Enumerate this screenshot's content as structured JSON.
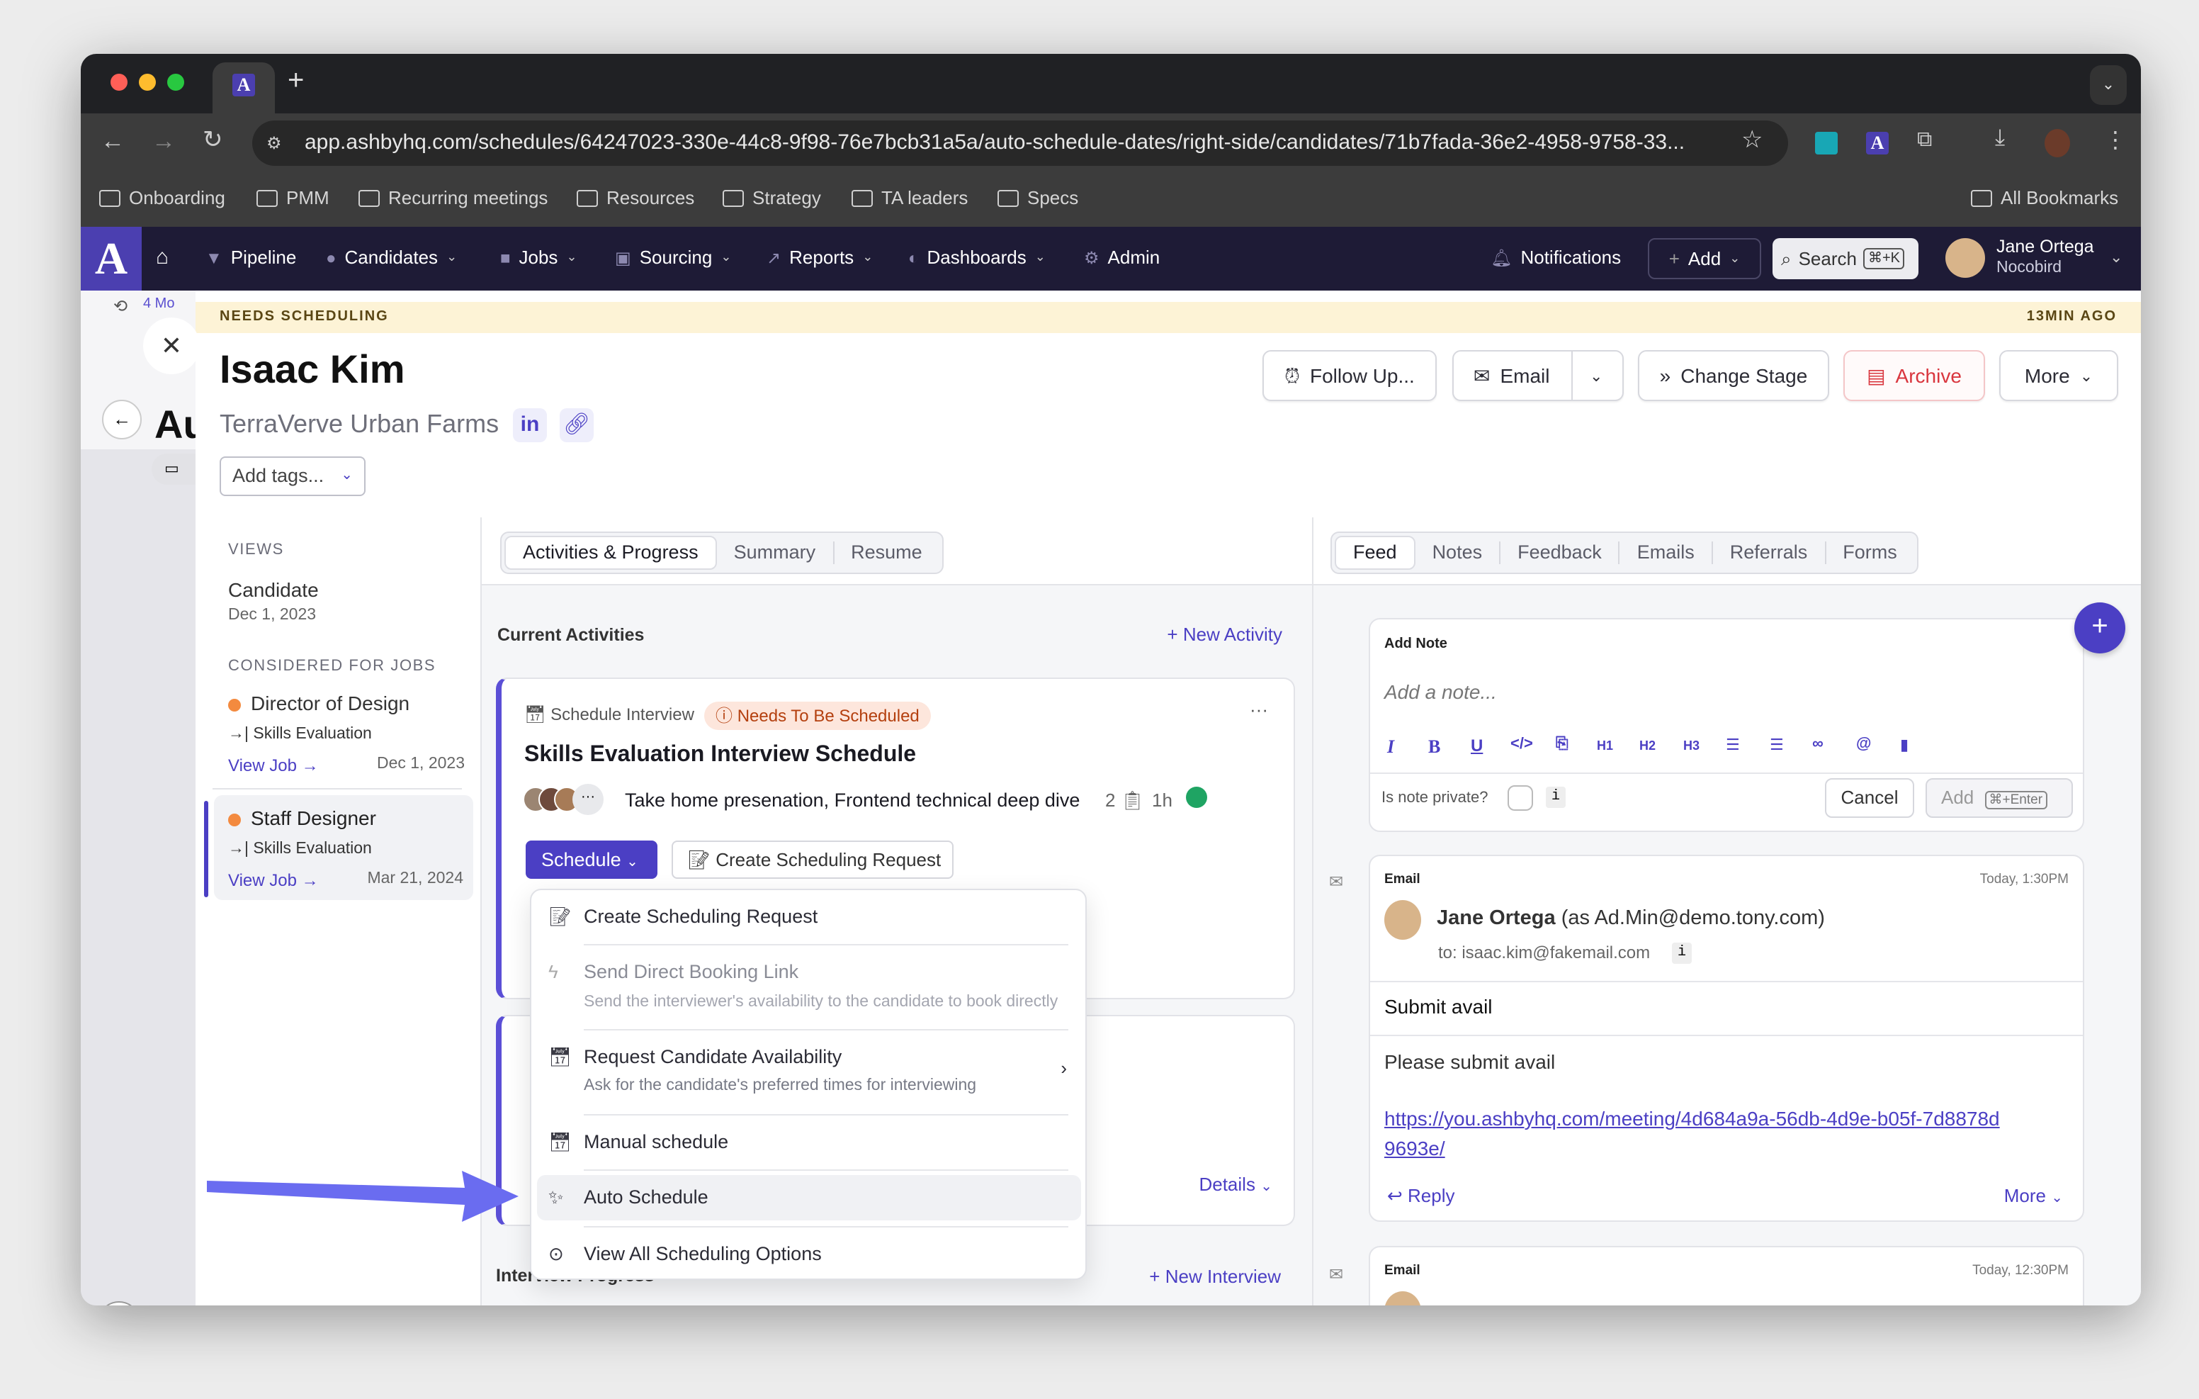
{
  "browser": {
    "url": "app.ashbyhq.com/schedules/64247023-330e-44c8-9f98-76e7bcb31a5a/auto-schedule-dates/right-side/candidates/71b7fada-36e2-4958-9758-33...",
    "tab_icon": "A",
    "bookmarks": [
      "Onboarding",
      "PMM",
      "Recurring meetings",
      "Resources",
      "Strategy",
      "TA leaders",
      "Specs"
    ],
    "all_bookmarks": "All Bookmarks"
  },
  "nav": {
    "logo": "A",
    "items": [
      "Pipeline",
      "Candidates",
      "Jobs",
      "Sourcing",
      "Reports",
      "Dashboards",
      "Admin"
    ],
    "notifications": "Notifications",
    "add": "Add",
    "search": "Search",
    "search_shortcut": "⌘+K",
    "user_name": "Jane Ortega",
    "user_org": "Nocobird"
  },
  "background_page": {
    "title_fragment": "Au",
    "history_fragment": "4 Mo"
  },
  "banner": {
    "status": "NEEDS SCHEDULING",
    "time": "13MIN AGO"
  },
  "candidate": {
    "name": "Isaac Kim",
    "company": "TerraVerve Urban Farms",
    "linkedin": "in",
    "tags_placeholder": "Add tags..."
  },
  "actions": {
    "follow_up": "Follow Up...",
    "email": "Email",
    "change_stage": "Change Stage",
    "archive": "Archive",
    "more": "More"
  },
  "left": {
    "views_label": "VIEWS",
    "view_name": "Candidate",
    "view_date": "Dec 1, 2023",
    "jobs_label": "CONSIDERED FOR JOBS",
    "jobs": [
      {
        "title": "Director of Design",
        "stage": "Skills Evaluation",
        "link": "View Job",
        "date": "Dec 1, 2023"
      },
      {
        "title": "Staff Designer",
        "stage": "Skills Evaluation",
        "link": "View Job",
        "date": "Mar 21, 2024"
      }
    ]
  },
  "middle": {
    "tabs": [
      "Activities & Progress",
      "Summary",
      "Resume"
    ],
    "section": "Current Activities",
    "new_activity": "New Activity",
    "card": {
      "type": "Schedule Interview",
      "badge": "Needs To Be Scheduled",
      "title": "Skills Evaluation Interview Schedule",
      "interviews": "Take home presenation, Frontend technical deep dive",
      "count": "2",
      "duration": "1h",
      "schedule_btn": "Schedule",
      "create_request_btn": "Create Scheduling Request",
      "details": "Details"
    },
    "menu": [
      {
        "label": "Create Scheduling Request"
      },
      {
        "label": "Send Direct Booking Link",
        "sub": "Send the interviewer's availability to the candidate to book directly"
      },
      {
        "label": "Request Candidate Availability",
        "sub": "Ask for the candidate's preferred times for interviewing"
      },
      {
        "label": "Manual schedule"
      },
      {
        "label": "Auto Schedule"
      },
      {
        "label": "View All Scheduling Options"
      }
    ],
    "interview_progress": "Interview Progress",
    "new_interview": "New Interview"
  },
  "right": {
    "tabs": [
      "Feed",
      "Notes",
      "Feedback",
      "Emails",
      "Referrals",
      "Forms"
    ],
    "note": {
      "title": "Add Note",
      "placeholder": "Add a note...",
      "toolbar": [
        "H1",
        "H2",
        "H3"
      ],
      "private_label": "Is note private?",
      "info": "i",
      "cancel": "Cancel",
      "add": "Add",
      "add_shortcut": "⌘+Enter"
    },
    "emails": [
      {
        "label": "Email",
        "time": "Today, 1:30PM",
        "sender": "Jane Ortega",
        "as": "(as Ad.Min@demo.tony.com)",
        "to": "to: isaac.kim@fakemail.com",
        "subject": "Submit avail",
        "body": "Please submit avail",
        "link": "https://you.ashbyhq.com/meeting/4d684a9a-56db-4d9e-b05f-7d8878d9693e/",
        "reply": "Reply",
        "more": "More"
      },
      {
        "label": "Email",
        "time": "Today, 12:30PM"
      }
    ]
  },
  "help": "?",
  "colors": {
    "brand": "#4b3fc4",
    "nav_bg": "#1e1b36",
    "banner": "#fdf3d6",
    "archive": "#d9363e",
    "arrow": "#6a6cf0"
  }
}
